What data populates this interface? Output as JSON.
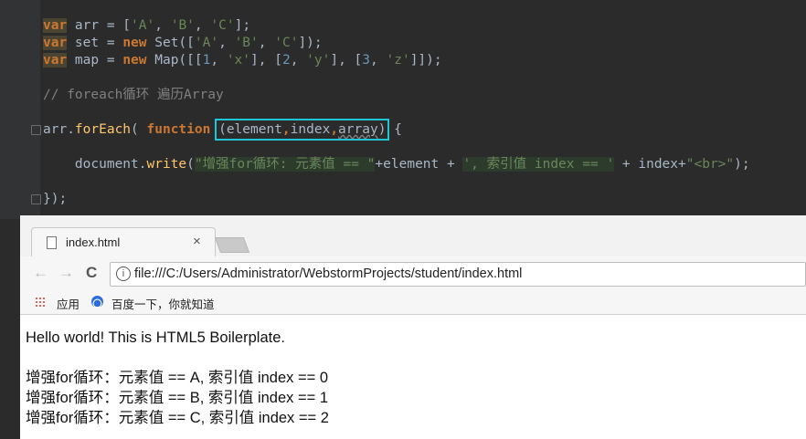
{
  "editor": {
    "lines": [
      {
        "kw": "var",
        "rest_a": " arr = [",
        "s1": "'A'",
        "c1": ", ",
        "s2": "'B'",
        "c2": ", ",
        "s3": "'C'",
        "end": "];"
      },
      {
        "kw": "var",
        "rest_a": " set = ",
        "kw2": "new",
        "rest_b": " Set([",
        "s1": "'A'",
        "c1": ", ",
        "s2": "'B'",
        "c2": ", ",
        "s3": "'C'",
        "end": "]);"
      },
      {
        "kw": "var",
        "rest_a": " map = ",
        "kw2": "new",
        "rest_b": " Map([[",
        "n1": "1",
        "c1": ", ",
        "s1": "'x'",
        "c2": "], [",
        "n2": "2",
        "c3": ", ",
        "s2": "'y'",
        "c4": "], [",
        "n3": "3",
        "c5": ", ",
        "s3": "'z'",
        "end": "]]);"
      }
    ],
    "comment": "// foreach循环 遍历Array",
    "foreach": {
      "obj": "arr.",
      "method": "forEach",
      "open": "( ",
      "kw": "function",
      "sp": " ",
      "params_open": "(",
      "p1": "element",
      "comma1": ",",
      "p2": "index",
      "comma2": ",",
      "p3": "array",
      "params_close": ")",
      "brace": " {"
    },
    "body": {
      "indent": "    document.",
      "method": "write",
      "open": "(",
      "s1": "\"增强for循环: 元素值 == \"",
      "mid1": "+element + ",
      "s2": "', 索引值 index == '",
      "mid2": " + index+",
      "s3": "\"<br>\"",
      "end": ");"
    },
    "close": "});"
  },
  "browser": {
    "tab_title": "index.html",
    "tab_close": "×",
    "nav": {
      "back": "←",
      "forward": "→",
      "reload": "C"
    },
    "info_icon": "i",
    "url": "file:///C:/Users/Administrator/WebstormProjects/student/index.html",
    "bookmarks": [
      "应用",
      "百度一下，你就知道"
    ],
    "content": {
      "heading": "Hello world! This is HTML5 Boilerplate.",
      "lines": [
        "增强for循环：元素值 == A, 索引值 index == 0",
        "增强for循环：元素值 == B, 索引值 index == 1",
        "增强for循环：元素值 == C, 索引值 index == 2"
      ]
    }
  },
  "icons": [
    "page-icon",
    "close-icon",
    "back-arrow-icon",
    "forward-arrow-icon",
    "reload-icon",
    "info-icon",
    "apps-grid-icon",
    "baidu-paw-icon",
    "fold-marker-icon"
  ],
  "colors": {
    "editor_bg": "#2b2b2b",
    "keyword": "#cc7832",
    "string": "#6a8759",
    "number": "#6897bb",
    "function": "#ffc66d",
    "comment": "#808080",
    "highlight_box": "#1ec6d6"
  }
}
